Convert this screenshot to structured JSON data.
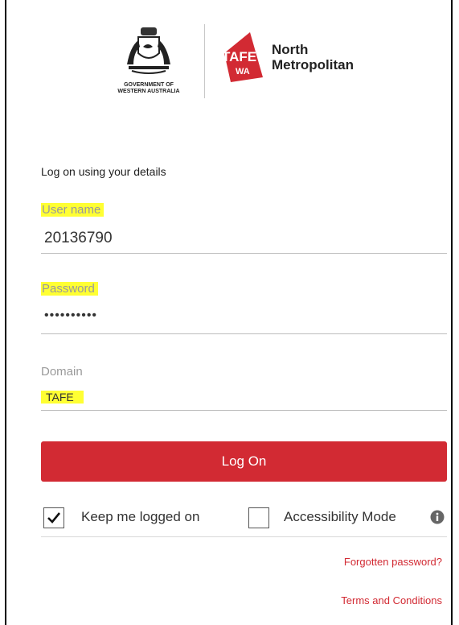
{
  "branding": {
    "government_line1": "GOVERNMENT OF",
    "government_line2": "WESTERN AUSTRALIA",
    "tafe_mark": "TAFE",
    "tafe_mark_sub": "WA",
    "institute_line1": "North",
    "institute_line2": "Metropolitan"
  },
  "form": {
    "heading": "Log on using your details",
    "username": {
      "label": "User name",
      "value": "20136790"
    },
    "password": {
      "label": "Password",
      "value": "••••••••••"
    },
    "domain": {
      "label": "Domain",
      "value": "TAFE"
    },
    "logon_label": "Log On",
    "keep_logged_on_label": "Keep me logged on",
    "keep_logged_on_checked": true,
    "accessibility_label": "Accessibility Mode",
    "accessibility_checked": false,
    "forgotten_password_link": "Forgotten password?",
    "terms_link": "Terms and Conditions"
  },
  "colors": {
    "accent": "#d22a33",
    "highlight": "#ffff33"
  }
}
